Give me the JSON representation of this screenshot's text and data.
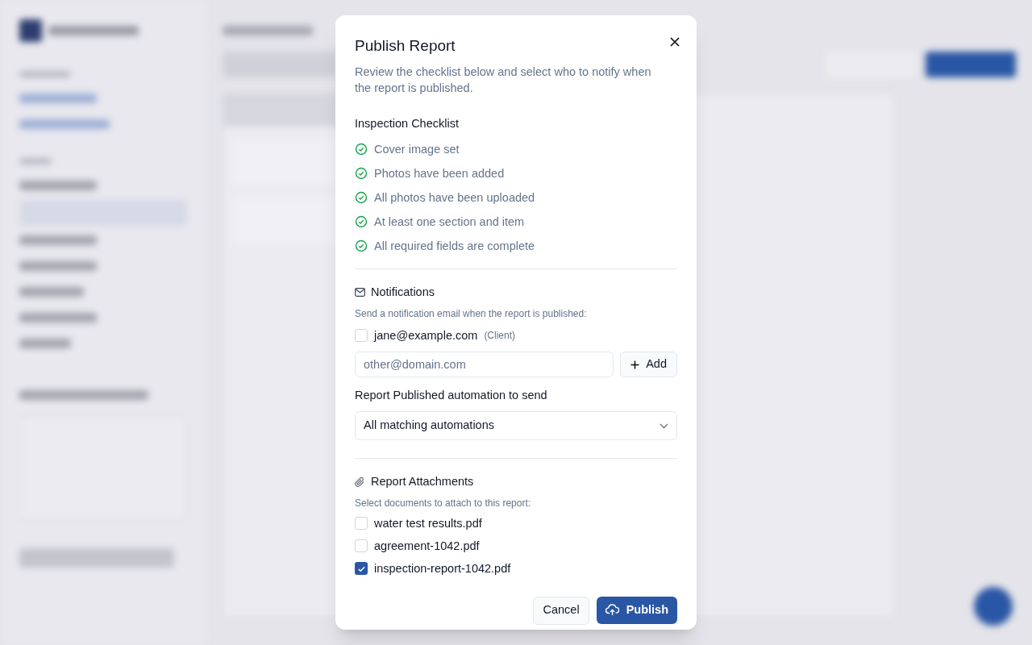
{
  "dialog": {
    "title": "Publish Report",
    "description": "Review the checklist below and select who to notify when the report is published.",
    "checklist": {
      "heading": "Inspection Checklist",
      "items": [
        {
          "label": "Cover image set",
          "done": true
        },
        {
          "label": "Photos have been added",
          "done": true
        },
        {
          "label": "All photos have been uploaded",
          "done": true
        },
        {
          "label": "At least one section and item",
          "done": true
        },
        {
          "label": "All required fields are complete",
          "done": true
        }
      ]
    },
    "notifications": {
      "heading": "Notifications",
      "hint": "Send a notification email when the report is published:",
      "recipients": [
        {
          "email": "jane@example.com",
          "role": "(Client)",
          "checked": false
        }
      ],
      "email_field": {
        "placeholder": "other@domain.com"
      },
      "add_button": "Add",
      "automation_label": "Report Published automation to send",
      "automation_select": "All matching automations"
    },
    "attachments": {
      "heading": "Report Attachments",
      "hint": "Select documents to attach to this report:",
      "files": [
        {
          "name": "water test results.pdf",
          "checked": false
        },
        {
          "name": "agreement-1042.pdf",
          "checked": false
        },
        {
          "name": "inspection-report-1042.pdf",
          "checked": true
        }
      ]
    },
    "buttons": {
      "cancel": "Cancel",
      "publish": "Publish"
    }
  }
}
